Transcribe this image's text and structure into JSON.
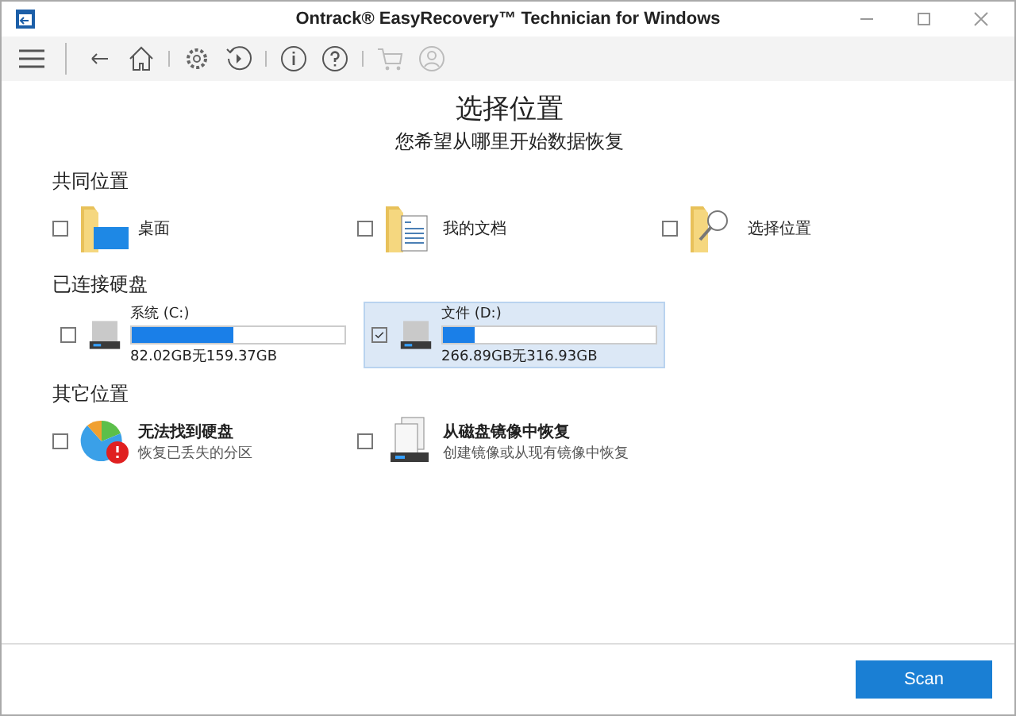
{
  "window": {
    "title": "Ontrack® EasyRecovery™ Technician for Windows"
  },
  "heading": "选择位置",
  "subheading": "您希望从哪里开始数据恢复",
  "common": {
    "title": "共同位置",
    "items": [
      {
        "kind": "desktop",
        "label": "桌面",
        "checked": false
      },
      {
        "kind": "documents",
        "label": "我的文档",
        "checked": false
      },
      {
        "kind": "browse",
        "label": "选择位置",
        "checked": false
      }
    ]
  },
  "drives": {
    "title": "已连接硬盘",
    "items": [
      {
        "label": "系统 (C:)",
        "level": 0.48,
        "usage": "82.02GB无159.37GB",
        "checked": false,
        "selected": false
      },
      {
        "label": "文件 (D:)",
        "level": 0.15,
        "usage": "266.89GB无316.93GB",
        "checked": true,
        "selected": true
      }
    ]
  },
  "other": {
    "title": "其它位置",
    "items": [
      {
        "kind": "lost",
        "label": "无法找到硬盘",
        "desc": "恢复已丢失的分区",
        "checked": false
      },
      {
        "kind": "image",
        "label": "从磁盘镜像中恢复",
        "desc": "创建镜像或从现有镜像中恢复",
        "checked": false
      }
    ]
  },
  "scan_button": "Scan"
}
